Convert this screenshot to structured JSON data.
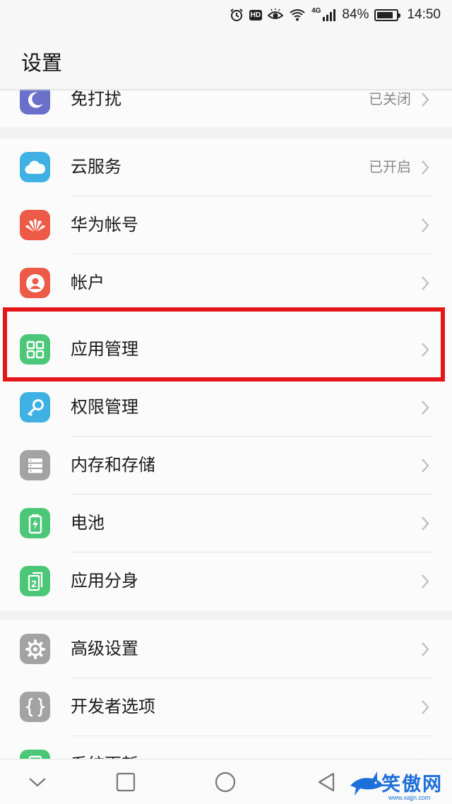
{
  "status_bar": {
    "network": "4G",
    "battery_percent": "84%",
    "battery_level": 0.84,
    "time": "14:50",
    "icons": [
      "alarm-icon",
      "hd-icon",
      "eye-comfort-icon",
      "wifi-icon",
      "signal-icon",
      "battery-icon"
    ]
  },
  "header": {
    "title": "设置"
  },
  "sections": {
    "top": {
      "items": [
        {
          "label": "免打扰",
          "status": "已关闭",
          "icon": "moon-icon",
          "color": "#6a6fc9"
        }
      ]
    },
    "accounts": {
      "items": [
        {
          "label": "云服务",
          "status": "已开启",
          "icon": "cloud-icon",
          "color": "#3fb1e4"
        },
        {
          "label": "华为帐号",
          "status": "",
          "icon": "huawei-icon",
          "color": "#ed5a47"
        },
        {
          "label": "帐户",
          "status": "",
          "icon": "account-icon",
          "color": "#ed5a47"
        },
        {
          "label": "应用管理",
          "status": "",
          "icon": "app-grid-icon",
          "color": "#4cc777"
        },
        {
          "label": "权限管理",
          "status": "",
          "icon": "key-icon",
          "color": "#3fb1e4"
        },
        {
          "label": "内存和存储",
          "status": "",
          "icon": "storage-icon",
          "color": "#a3a3a3"
        },
        {
          "label": "电池",
          "status": "",
          "icon": "battery-icon",
          "color": "#4cc777"
        },
        {
          "label": "应用分身",
          "status": "",
          "icon": "app-twin-icon",
          "color": "#4cc777"
        }
      ]
    },
    "advanced": {
      "items": [
        {
          "label": "高级设置",
          "status": "",
          "icon": "gear-icon",
          "color": "#a3a3a3"
        },
        {
          "label": "开发者选项",
          "status": "",
          "icon": "braces-icon",
          "color": "#a3a3a3"
        },
        {
          "label": "系统更新",
          "status": "",
          "icon": "phone-update-icon",
          "color": "#4cc777"
        }
      ]
    }
  },
  "highlight": {
    "target": "应用管理",
    "color": "#e5161a"
  },
  "nav_bar": {
    "icons": [
      "collapse-icon",
      "recents-icon",
      "home-icon",
      "back-icon"
    ]
  },
  "watermark": {
    "text": "笑傲网",
    "url": "www.xajjn.com",
    "color": "#1d6fd9"
  }
}
